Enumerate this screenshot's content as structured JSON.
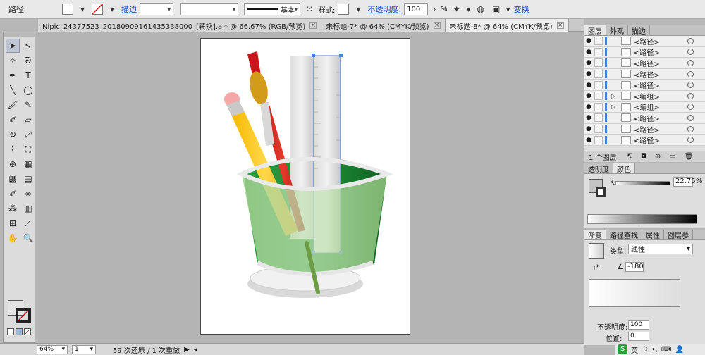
{
  "control_bar": {
    "object_type": "路径",
    "stroke_label": "描边",
    "stroke_style": "基本",
    "style_label": "样式:",
    "opacity_label": "不透明度:",
    "opacity_value": "100",
    "opacity_unit": "%",
    "transform_label": "变换"
  },
  "tabs": [
    {
      "label": "Nipic_24377523_20180909161435338000_[转换].ai* @ 66.67% (RGB/预览)",
      "active": false
    },
    {
      "label": "未标题-7* @ 64% (CMYK/预览)",
      "active": false
    },
    {
      "label": "未标题-8* @ 64% (CMYK/预览)",
      "active": true
    }
  ],
  "status_bar": {
    "zoom": "64%",
    "page": "1",
    "history": "59 次还原 / 1 次重做"
  },
  "layers_panel": {
    "tabs": [
      "图层",
      "外观",
      "描边"
    ],
    "rows": [
      {
        "name": "<路径>",
        "expand": false
      },
      {
        "name": "<路径>",
        "expand": false
      },
      {
        "name": "<路径>",
        "expand": false
      },
      {
        "name": "<路径>",
        "expand": false
      },
      {
        "name": "<路径>",
        "expand": false
      },
      {
        "name": "<编组>",
        "expand": true
      },
      {
        "name": "<编组>",
        "expand": true
      },
      {
        "name": "<路径>",
        "expand": false
      },
      {
        "name": "<路径>",
        "expand": false
      },
      {
        "name": "<路径>",
        "expand": false
      }
    ],
    "footer_count": "1 个图层"
  },
  "color_panel": {
    "tabs": [
      "透明度",
      "颜色"
    ],
    "channel": "K",
    "value": "22.75",
    "unit": "%"
  },
  "gradient_panel": {
    "tabs": [
      "渐变",
      "路径查找",
      "属性",
      "图层参"
    ],
    "type_label": "类型:",
    "type_value": "线性",
    "angle": "-180",
    "opacity_label": "不透明度:",
    "opacity_value": "100",
    "position_label": "位置:",
    "position_value": "0"
  },
  "taskbar": {
    "ime": "英"
  },
  "colors": {
    "accent_blue": "#4a7fd8",
    "cup_green": "#1e8a3a",
    "pencil_yellow": "#f3c21a",
    "brush_red": "#d02a20"
  }
}
